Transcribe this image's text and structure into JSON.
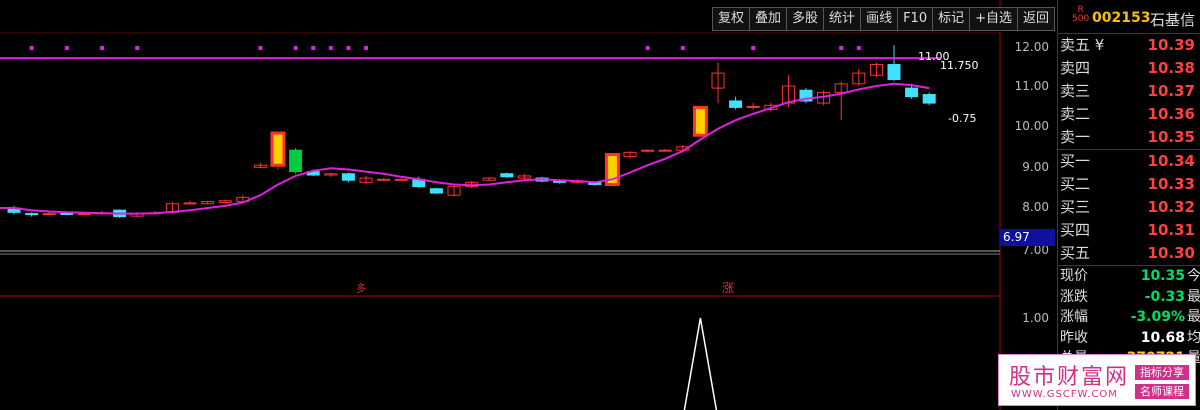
{
  "toolbar": {
    "buttons": [
      "复权",
      "叠加",
      "多股",
      "统计",
      "画线",
      "F10",
      "标记",
      "+自选",
      "返回"
    ]
  },
  "stock": {
    "badge_top": "R",
    "badge_bottom": "500",
    "code": "002153",
    "name": "石基信"
  },
  "price_axis": {
    "labels": [
      "12.00",
      "11.00",
      "10.00",
      "9.00",
      "8.00",
      "7.00"
    ],
    "current_tag": "6.97",
    "sub_label": "1.00"
  },
  "annotations": {
    "high_value": "11.00",
    "high_line": "11.750",
    "pct": "-0.75",
    "mark_left": "多",
    "mark_right": "涨"
  },
  "order_book": {
    "sell": [
      {
        "label": "卖五 ¥",
        "price": "10.39"
      },
      {
        "label": "卖四",
        "price": "10.38"
      },
      {
        "label": "卖三",
        "price": "10.37"
      },
      {
        "label": "卖二",
        "price": "10.36"
      },
      {
        "label": "卖一",
        "price": "10.35"
      }
    ],
    "buy": [
      {
        "label": "买一",
        "price": "10.34"
      },
      {
        "label": "买二",
        "price": "10.33"
      },
      {
        "label": "买三",
        "price": "10.32"
      },
      {
        "label": "买四",
        "price": "10.31"
      },
      {
        "label": "买五",
        "price": "10.30"
      }
    ]
  },
  "stats": [
    {
      "label": "现价",
      "value": "10.35",
      "suffix": "今"
    },
    {
      "label": "涨跌",
      "value": "-0.33",
      "suffix": "最"
    },
    {
      "label": "涨幅",
      "value": "-3.09%",
      "suffix": "最"
    },
    {
      "label": "昨收",
      "value": "10.68",
      "suffix": "均"
    },
    {
      "label": "总量",
      "value": "370721",
      "suffix": "量"
    }
  ],
  "watermark": {
    "main": "股市财富网",
    "url": "WWW.GSCFW.COM",
    "tag1": "指标分享",
    "tag2": "名师课程"
  },
  "colors": {
    "up": "#ff3030",
    "down": "#40e0ff",
    "ma": "#e020e0",
    "highlight_fill": "#ffd000",
    "green_bar": "#00cc40"
  },
  "chart_data": {
    "type": "candlestick",
    "ylim": [
      6.97,
      12.2
    ],
    "candles": [
      [
        7.95,
        7.85,
        8.0,
        7.8,
        "d"
      ],
      [
        7.82,
        7.8,
        7.85,
        7.75,
        "d"
      ],
      [
        7.8,
        7.82,
        7.88,
        7.78,
        "u"
      ],
      [
        7.84,
        7.8,
        7.87,
        7.78,
        "d"
      ],
      [
        7.8,
        7.82,
        7.86,
        7.79,
        "u"
      ],
      [
        7.82,
        7.84,
        7.88,
        7.8,
        "u"
      ],
      [
        7.9,
        7.75,
        7.92,
        7.72,
        "d"
      ],
      [
        7.76,
        7.82,
        7.86,
        7.74,
        "u"
      ],
      [
        7.82,
        7.84,
        7.88,
        7.8,
        "u"
      ],
      [
        7.85,
        8.05,
        8.1,
        7.82,
        "u"
      ],
      [
        8.05,
        8.07,
        8.12,
        8.03,
        "u"
      ],
      [
        8.05,
        8.1,
        8.12,
        8.03,
        "u"
      ],
      [
        8.08,
        8.12,
        8.15,
        8.05,
        "u"
      ],
      [
        8.1,
        8.2,
        8.25,
        8.08,
        "u"
      ],
      [
        8.9,
        8.95,
        9.0,
        8.88,
        "u"
      ],
      [
        8.95,
        9.7,
        9.7,
        8.85,
        "y"
      ],
      [
        9.3,
        8.8,
        9.35,
        8.75,
        "g"
      ],
      [
        8.8,
        8.72,
        8.85,
        8.7,
        "d"
      ],
      [
        8.72,
        8.75,
        8.78,
        8.68,
        "u"
      ],
      [
        8.75,
        8.6,
        8.78,
        8.55,
        "d"
      ],
      [
        8.55,
        8.65,
        8.7,
        8.5,
        "u"
      ],
      [
        8.6,
        8.62,
        8.65,
        8.58,
        "u"
      ],
      [
        8.6,
        8.62,
        8.65,
        8.58,
        "u"
      ],
      [
        8.62,
        8.45,
        8.68,
        8.42,
        "d"
      ],
      [
        8.4,
        8.3,
        8.42,
        8.28,
        "d"
      ],
      [
        8.25,
        8.45,
        8.48,
        8.22,
        "u"
      ],
      [
        8.45,
        8.55,
        8.58,
        8.42,
        "u"
      ],
      [
        8.6,
        8.65,
        8.68,
        8.58,
        "u"
      ],
      [
        8.75,
        8.68,
        8.78,
        8.65,
        "d"
      ],
      [
        8.65,
        8.7,
        8.75,
        8.62,
        "u"
      ],
      [
        8.65,
        8.58,
        8.68,
        8.55,
        "d"
      ],
      [
        8.6,
        8.55,
        8.62,
        8.52,
        "d"
      ],
      [
        8.55,
        8.58,
        8.62,
        8.52,
        "u"
      ],
      [
        8.55,
        8.5,
        8.58,
        8.47,
        "d"
      ],
      [
        8.5,
        9.2,
        9.2,
        8.48,
        "y"
      ],
      [
        9.15,
        9.25,
        9.28,
        9.1,
        "u"
      ],
      [
        9.28,
        9.3,
        9.32,
        9.25,
        "u"
      ],
      [
        9.3,
        9.3,
        9.33,
        9.27,
        "u"
      ],
      [
        9.3,
        9.38,
        9.42,
        9.25,
        "u"
      ],
      [
        9.65,
        10.3,
        10.3,
        9.62,
        "y"
      ],
      [
        10.75,
        11.1,
        11.35,
        10.4,
        "u"
      ],
      [
        10.45,
        10.3,
        10.55,
        10.25,
        "d"
      ],
      [
        10.3,
        10.32,
        10.4,
        10.25,
        "u"
      ],
      [
        10.25,
        10.35,
        10.4,
        10.2,
        "u"
      ],
      [
        10.4,
        10.8,
        11.05,
        10.3,
        "u"
      ],
      [
        10.7,
        10.45,
        10.75,
        10.4,
        "d"
      ],
      [
        10.4,
        10.65,
        10.7,
        10.35,
        "u"
      ],
      [
        10.65,
        10.85,
        10.9,
        10.0,
        "u"
      ],
      [
        10.85,
        11.1,
        11.2,
        10.8,
        "u"
      ],
      [
        11.05,
        11.3,
        11.35,
        11.0,
        "u"
      ],
      [
        11.3,
        10.95,
        11.75,
        10.92,
        "d"
      ],
      [
        10.75,
        10.55,
        10.85,
        10.5,
        "d"
      ],
      [
        10.6,
        10.4,
        10.65,
        10.35,
        "d"
      ]
    ],
    "ma": [
      7.95,
      7.9,
      7.87,
      7.85,
      7.84,
      7.83,
      7.82,
      7.82,
      7.83,
      7.86,
      7.9,
      7.95,
      8.0,
      8.08,
      8.25,
      8.5,
      8.7,
      8.82,
      8.88,
      8.85,
      8.8,
      8.75,
      8.68,
      8.62,
      8.55,
      8.5,
      8.48,
      8.5,
      8.55,
      8.6,
      8.62,
      8.6,
      8.58,
      8.55,
      8.62,
      8.78,
      8.95,
      9.1,
      9.28,
      9.55,
      9.8,
      10.0,
      10.15,
      10.28,
      10.42,
      10.5,
      10.55,
      10.62,
      10.72,
      10.8,
      10.85,
      10.82,
      10.75
    ],
    "resistance_line": 11.45,
    "volume_spike": {
      "index": 39,
      "value": 1.0
    }
  }
}
